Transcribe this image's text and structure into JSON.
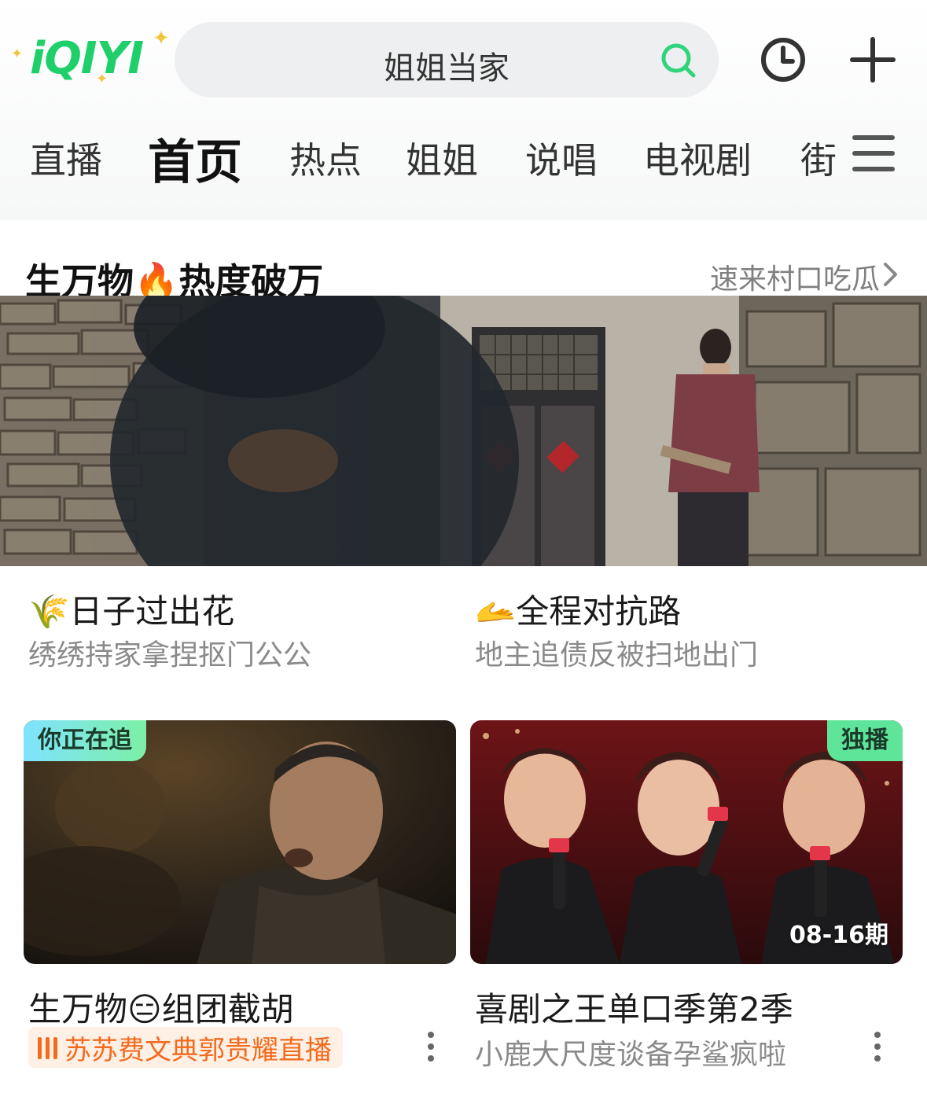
{
  "header": {
    "logo_text": "iQIYI",
    "search": {
      "query": "姐姐当家"
    }
  },
  "tabs": [
    {
      "label": "直播",
      "active": false
    },
    {
      "label": "首页",
      "active": true
    },
    {
      "label": "热点",
      "active": false
    },
    {
      "label": "姐姐",
      "active": false
    },
    {
      "label": "说唱",
      "active": false
    },
    {
      "label": "电视剧",
      "active": false
    },
    {
      "label": "街",
      "active": false
    }
  ],
  "section": {
    "title": "生万物🔥热度破万",
    "more_label": "速来村口吃瓜"
  },
  "hero_captions": [
    {
      "emoji": "🌾",
      "title": "日子过出花",
      "subtitle": "绣绣持家拿捏抠门公公"
    },
    {
      "emoji": "🫴",
      "title": "全程对抗路",
      "subtitle": "地主追债反被扫地出门"
    }
  ],
  "cards": [
    {
      "tag": "你正在追",
      "title": "生万物😑组团截胡",
      "live_text": "苏苏费文典郭贵耀直播",
      "episode": ""
    },
    {
      "tag": "独播",
      "title": "喜剧之王单口季第2季",
      "subtitle": "小鹿大尺度谈备孕鲨疯啦",
      "episode": "08-16期"
    }
  ],
  "colors": {
    "brand_green": "#1fd06a",
    "tag_green": "#5fe59a",
    "live_orange": "#f26b1d",
    "secondary_text": "#8a8a8a"
  },
  "icons": [
    "sparkle-icon",
    "search-icon",
    "history-icon",
    "plus-icon",
    "menu-icon",
    "chevron-right-icon",
    "live-bars-icon",
    "more-vertical-icon"
  ]
}
